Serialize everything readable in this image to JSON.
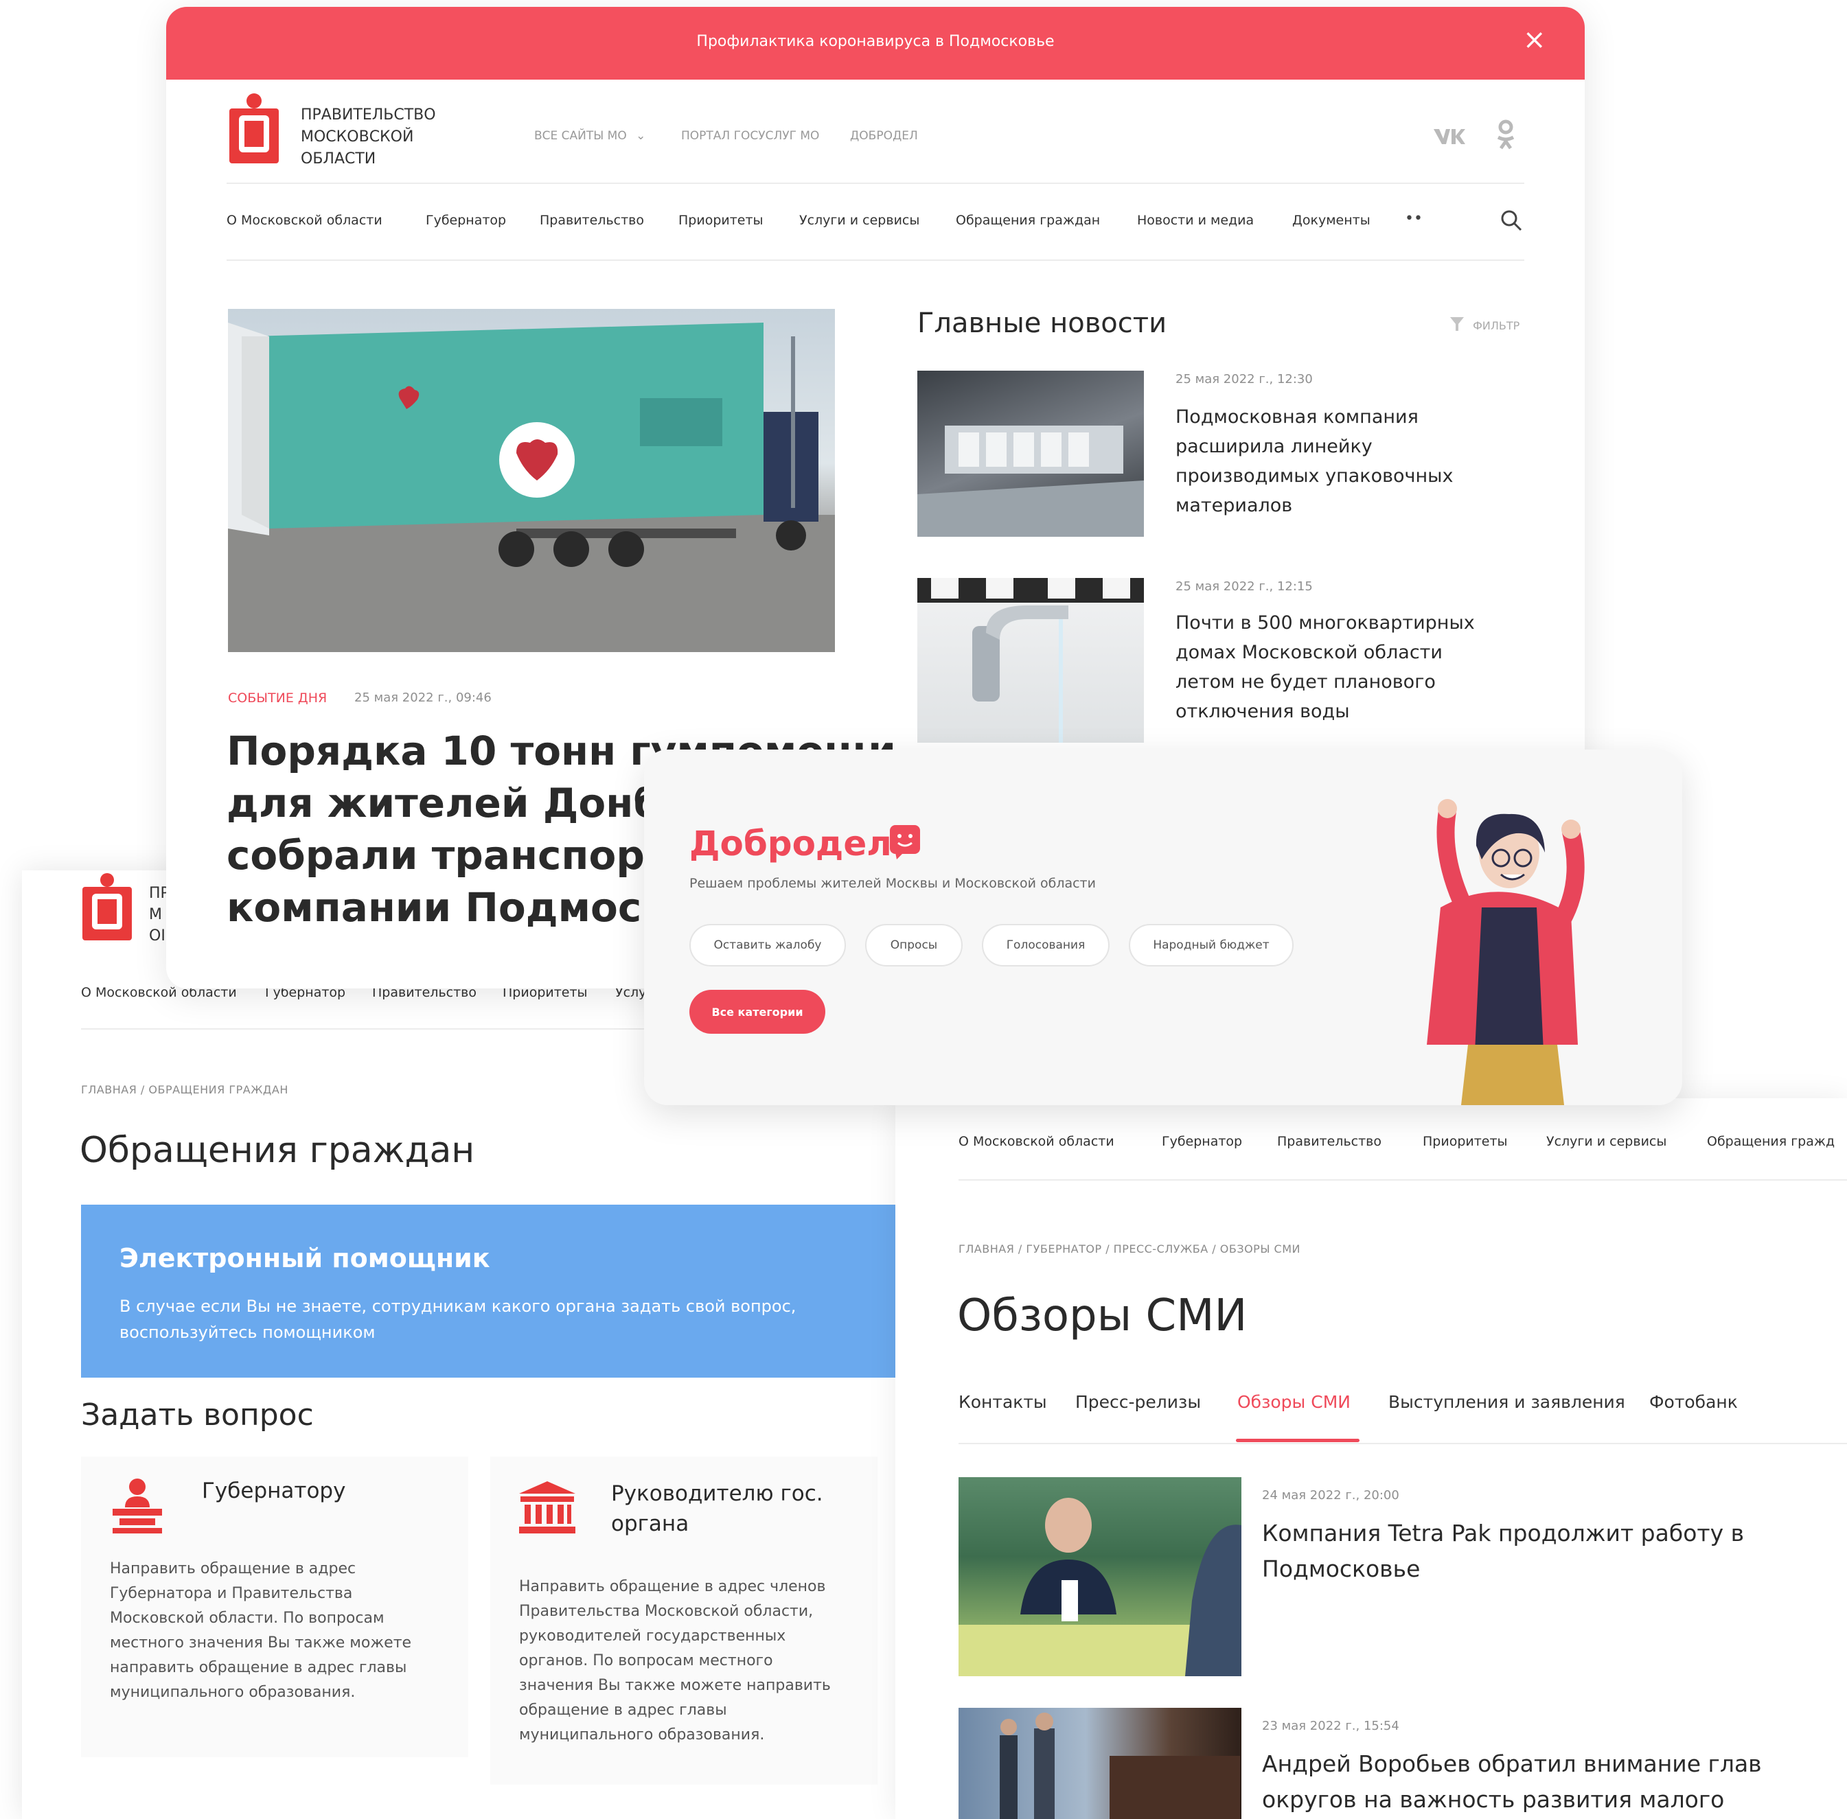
{
  "banner": {
    "text": "Профилактика коронавируса в Подмосковье",
    "close": "×"
  },
  "logo": {
    "line1": "ПРАВИТЕЛЬСТВО",
    "line2": "МОСКОВСКОЙ",
    "line3": "ОБЛАСТИ",
    "line1_short": "ПР",
    "line2_short": "М",
    "line3_short": "ОІ"
  },
  "topnav": {
    "all_sites": "ВСЕ САЙТЫ МО",
    "portal": "ПОРТАЛ ГОСУСЛУГ МО",
    "dobrodel": "ДОБРОДЕЛ"
  },
  "social": {
    "vk": "vk",
    "ok": "ok"
  },
  "mainnav": [
    "О Московской области",
    "Губернатор",
    "Правительство",
    "Приоритеты",
    "Услуги и сервисы",
    "Обращения граждан",
    "Новости и медиа",
    "Документы"
  ],
  "mainnav_more": "••",
  "hero": {
    "tag": "СОБЫТИЕ ДНЯ",
    "date": "25 мая 2022 г., 09:46",
    "title_l1": "Порядка 10 тонн гумпомощи",
    "title_l2": "для жителей Донбасса",
    "title_l3": "собрали транспортные",
    "title_l4": "компании Подмосковья"
  },
  "news": {
    "heading": "Главные новости",
    "filter": "ФИЛЬТР",
    "items": [
      {
        "date": "25 мая 2022 г., 12:30",
        "l1": "Подмосковная компания",
        "l2": "расширила линейку",
        "l3": "производимых упаковочных",
        "l4": "материалов"
      },
      {
        "date": "25 мая 2022 г., 12:15",
        "l1": "Почти в 500 многоквартирных",
        "l2": "домах Московской области",
        "l3": "летом не будет планового",
        "l4": "отключения воды"
      }
    ]
  },
  "dobrodel": {
    "title": "Добродел",
    "subtitle": "Решаем проблемы жителей Москвы и Московской области",
    "pills": [
      "Оставить жалобу",
      "Опросы",
      "Голосования",
      "Народный бюджет"
    ],
    "all": "Все категории"
  },
  "left_page": {
    "nav": [
      "О Московской области",
      "Губернатор",
      "Правительство",
      "Приоритеты",
      "Услу"
    ],
    "crumbs": "ГЛАВНАЯ  /  ОБРАЩЕНИЯ ГРАЖДАН",
    "title": "Обращения граждан",
    "helper_title": "Электронный помощник",
    "helper_l1": "В случае если Вы не знаете, сотрудникам какого органа задать свой вопрос,",
    "helper_l2": "воспользуйтесь помощником",
    "ask": "Задать вопрос",
    "card1": {
      "title": "Губернатору",
      "lines": [
        "Направить обращение в адрес",
        "Губернатора и Правительства",
        "Московской области. По вопросам",
        "местного значения Вы также можете",
        "направить обращение в адрес главы",
        "муниципального образования."
      ]
    },
    "card2": {
      "title_l1": "Руководителю гос.",
      "title_l2": "органа",
      "lines": [
        "Направить обращение в адрес членов",
        "Правительства Московской области,",
        "руководителей государственных",
        "органов. По вопросам местного",
        "значения Вы также можете направить",
        "обращение в адрес главы",
        "муниципального образования."
      ]
    }
  },
  "right_page": {
    "nav": [
      "О Московской области",
      "Губернатор",
      "Правительство",
      "Приоритеты",
      "Услуги и сервисы",
      "Обращения гражд"
    ],
    "crumbs": "ГЛАВНАЯ  /  ГУБЕРНАТОР  /  ПРЕСС-СЛУЖБА  /  ОБЗОРЫ СМИ",
    "title": "Обзоры СМИ",
    "tabs": [
      "Контакты",
      "Пресс-релизы",
      "Обзоры СМИ",
      "Выступления и заявления",
      "Фотобанк"
    ],
    "active_tab": 2,
    "items": [
      {
        "date": "24 мая 2022 г., 20:00",
        "l1": "Компания Tetra Pak продолжит работу в",
        "l2": "Подмосковье"
      },
      {
        "date": "23 мая 2022 г., 15:54",
        "l1": "Андрей Воробьев обратил внимание глав",
        "l2": "округов на важность развития малого"
      }
    ]
  },
  "colors": {
    "accent": "#ef4a5a",
    "banner": "#f4505e",
    "helper": "#6aa9ee",
    "text": "#2a2a2a"
  }
}
